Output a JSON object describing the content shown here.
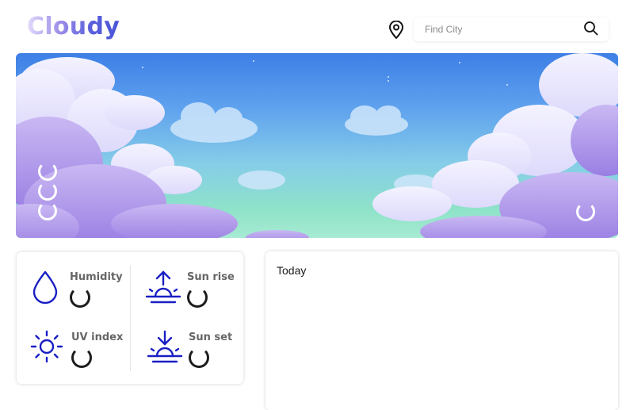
{
  "header": {
    "logo": "Cloudy",
    "location_icon": "location-pin-icon",
    "search": {
      "placeholder": "Find City",
      "value": "",
      "icon": "search-icon"
    }
  },
  "hero": {
    "background": "sky-clouds-illustration",
    "loading_indicators": [
      "spinner",
      "spinner",
      "spinner",
      "spinner"
    ]
  },
  "highlights": {
    "accent_color": "#1a1fc4",
    "items": [
      {
        "label": "Humidity",
        "icon": "droplet-icon",
        "value_state": "loading"
      },
      {
        "label": "Sun rise",
        "icon": "sunrise-icon",
        "value_state": "loading"
      },
      {
        "label": "UV index",
        "icon": "sun-icon",
        "value_state": "loading"
      },
      {
        "label": "Sun set",
        "icon": "sunset-icon",
        "value_state": "loading"
      }
    ]
  },
  "forecast": {
    "title": "Today"
  }
}
